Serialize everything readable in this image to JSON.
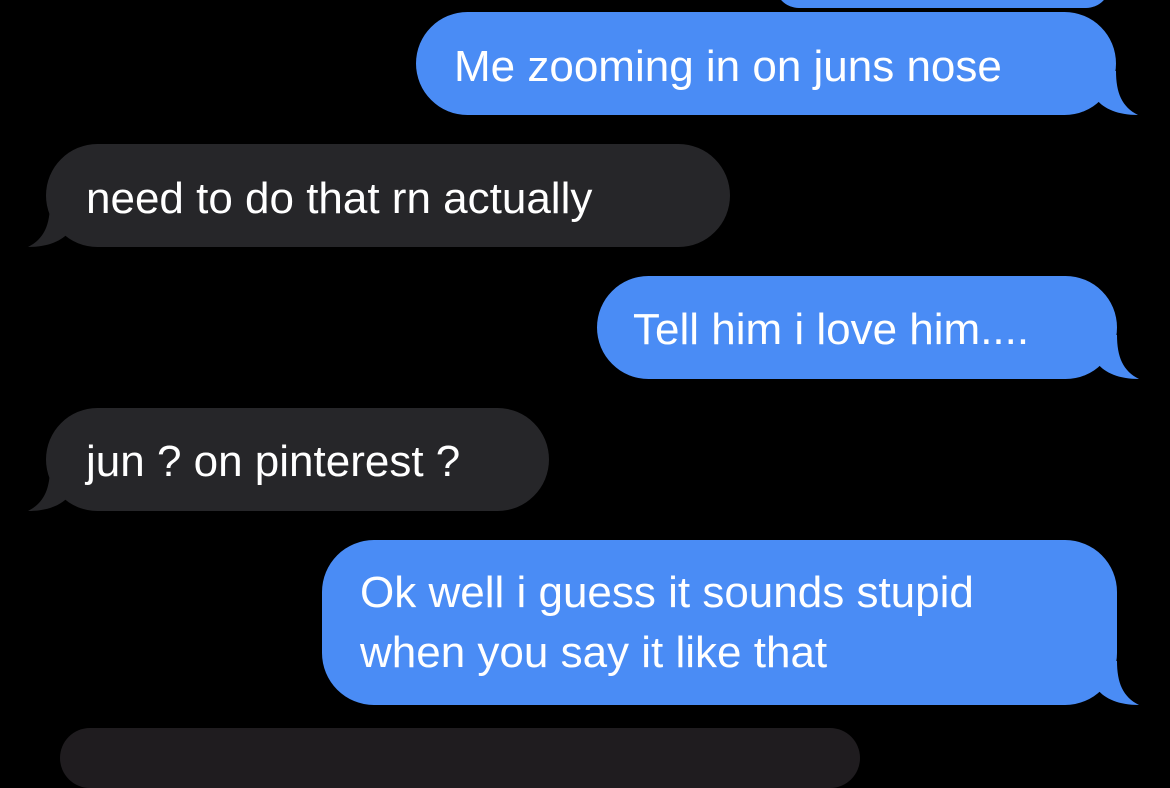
{
  "colors": {
    "background": "#000000",
    "sent_bubble": "#4a8cf5",
    "received_bubble": "#262629",
    "text": "#ffffff"
  },
  "messages": [
    {
      "direction": "sent",
      "text": ""
    },
    {
      "direction": "sent",
      "text": "Me zooming in on juns nose"
    },
    {
      "direction": "received",
      "text": "need to do that rn actually"
    },
    {
      "direction": "sent",
      "text": "Tell him i love him...."
    },
    {
      "direction": "received",
      "text": "jun ? on pinterest ?"
    },
    {
      "direction": "sent",
      "lines": [
        "Ok well i guess it sounds stupid",
        "when you say it like that"
      ]
    },
    {
      "direction": "received",
      "text": ""
    }
  ]
}
